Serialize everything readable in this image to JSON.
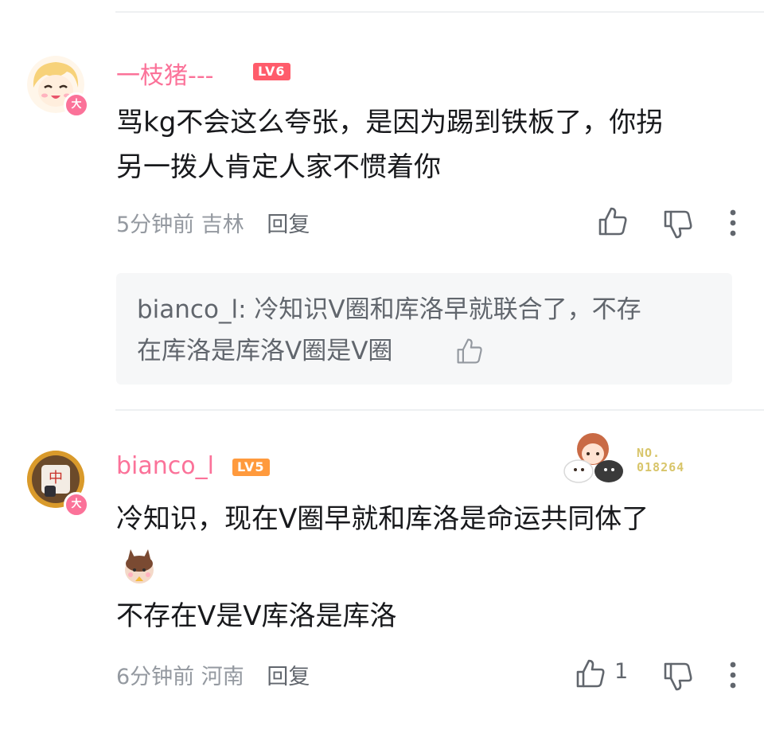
{
  "comments": [
    {
      "username": "一枝猪---",
      "level": "LV6",
      "text_line1": "骂kg不会这么夸张，是因为踢到铁板了，你拐",
      "text_line2": "另一拨人肯定人家不惯着你",
      "time": "5分钟前",
      "location": "吉林",
      "reply_label": "回复",
      "badge": "大",
      "reply_preview": {
        "username": "bianco_l",
        "separator": ": ",
        "text_line1": "冷知识V圈和库洛早就联合了，不存",
        "text_line2": "在库洛是库洛V圈是V圈"
      }
    },
    {
      "username": "bianco_l",
      "level": "LV5",
      "text_line1": "冷知识，现在V圈早就和库洛是命运共同体了",
      "text_line2": "不存在V是V库洛是库洛",
      "time": "6分钟前",
      "location": "河南",
      "reply_label": "回复",
      "badge": "大",
      "like_count": "1",
      "fan_badge_no": "NO.",
      "fan_badge_number": "018264",
      "avatar_glyph": "中"
    }
  ],
  "icons": {
    "like": "thumb-up-icon",
    "dislike": "thumb-down-icon",
    "more": "more-vertical-icon"
  },
  "colors": {
    "username": "#fb7299",
    "lv6": "#ff5c6b",
    "lv5": "#ff9a3d",
    "meta": "#9499a0"
  }
}
